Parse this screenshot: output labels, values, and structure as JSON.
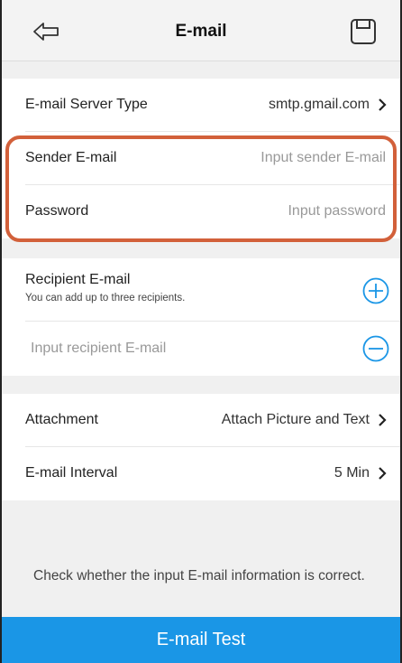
{
  "header": {
    "title": "E-mail",
    "back_icon": "back-arrow-icon",
    "save_icon": "save-icon"
  },
  "server": {
    "label": "E-mail Server Type",
    "value": "smtp.gmail.com"
  },
  "sender": {
    "label": "Sender E-mail",
    "placeholder": "Input sender E-mail"
  },
  "password": {
    "label": "Password",
    "placeholder": "Input password"
  },
  "recipient": {
    "label": "Recipient E-mail",
    "hint": "You can add up to three recipients.",
    "input_placeholder": "Input recipient E-mail"
  },
  "attachment": {
    "label": "Attachment",
    "value": "Attach Picture and Text"
  },
  "interval": {
    "label": "E-mail Interval",
    "value": "5 Min"
  },
  "footer": {
    "note": "Check whether the input E-mail information is correct.",
    "test_button": "E-mail Test"
  },
  "colors": {
    "accent": "#1a96e6",
    "highlight": "#d2603a"
  }
}
